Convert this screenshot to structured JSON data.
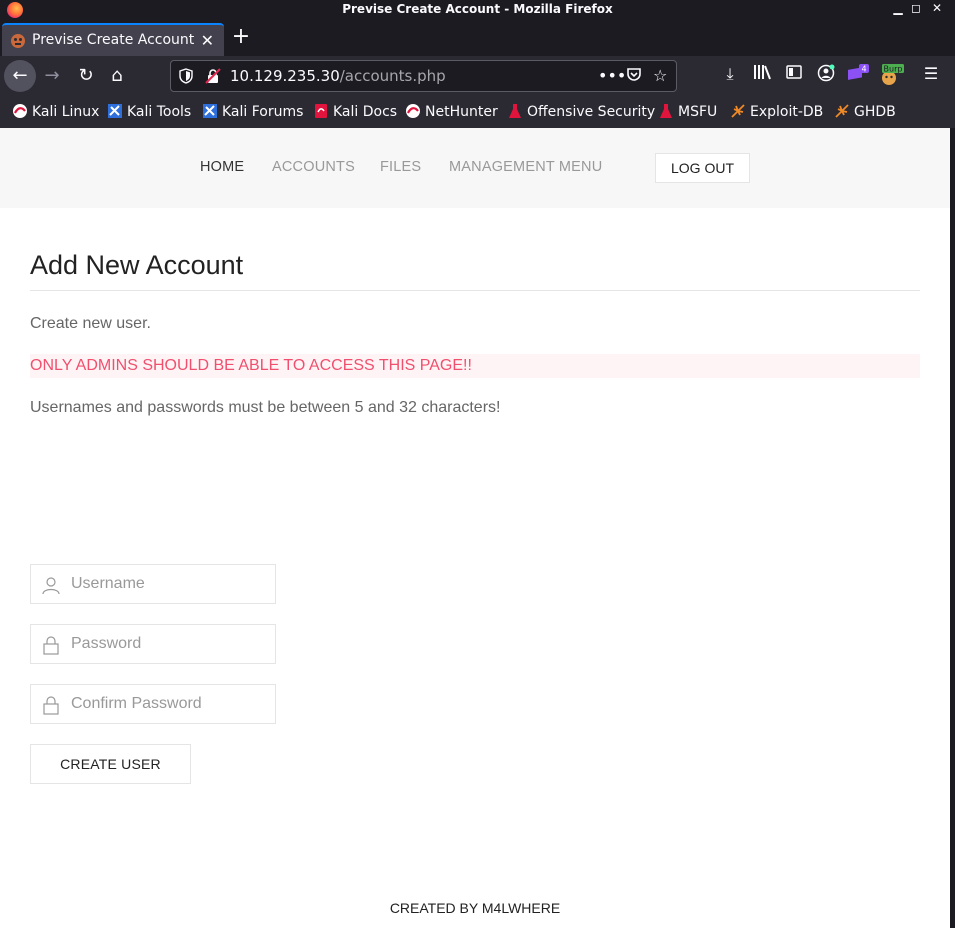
{
  "window": {
    "title": "Previse Create Account - Mozilla Firefox"
  },
  "tab": {
    "title": "Previse Create Account",
    "close": "✕"
  },
  "urlbar": {
    "host": "10.129.235.30",
    "path": "/accounts.php"
  },
  "toolbar": {
    "ext_badge": "4",
    "burp_label": "Burp"
  },
  "bookmarks": [
    {
      "label": "Kali Linux",
      "icon": "kali-icon"
    },
    {
      "label": "Kali Tools",
      "icon": "kali-tools-icon"
    },
    {
      "label": "Kali Forums",
      "icon": "kali-forums-icon"
    },
    {
      "label": "Kali Docs",
      "icon": "kali-docs-icon"
    },
    {
      "label": "NetHunter",
      "icon": "nethunter-icon"
    },
    {
      "label": "Offensive Security",
      "icon": "offsec-icon"
    },
    {
      "label": "MSFU",
      "icon": "msfu-icon"
    },
    {
      "label": "Exploit-DB",
      "icon": "exploitdb-icon"
    },
    {
      "label": "GHDB",
      "icon": "ghdb-icon"
    }
  ],
  "nav": {
    "home": "HOME",
    "accounts": "ACCOUNTS",
    "files": "FILES",
    "management": "MANAGEMENT MENU",
    "logout": "LOG OUT"
  },
  "main": {
    "heading": "Add New Account",
    "description": "Create new user.",
    "alert": "ONLY ADMINS SHOULD BE ABLE TO ACCESS THIS PAGE!!",
    "rule": "Usernames and passwords must be between 5 and 32 characters!",
    "username_placeholder": "Username",
    "password_placeholder": "Password",
    "confirm_placeholder": "Confirm Password",
    "submit_label": "CREATE USER"
  },
  "footer": {
    "text": "CREATED BY M4LWHERE"
  },
  "colors": {
    "accent": "#0a84ff",
    "alert": "#f0506e",
    "alert_bg": "#fef4f6"
  }
}
